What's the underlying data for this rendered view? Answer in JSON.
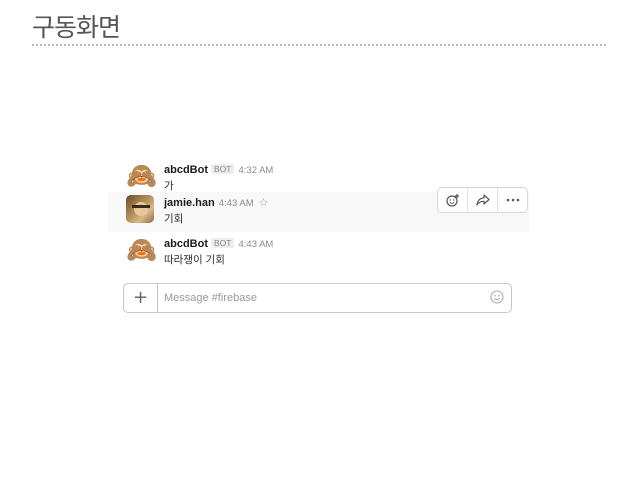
{
  "slide": {
    "title": "구동화면"
  },
  "messages": [
    {
      "author": "abcdBot",
      "badge": "BOT",
      "time": "4:32 AM",
      "text": "가",
      "avatar_icon": "see-no-evil-monkey-emoji"
    },
    {
      "author": "jamie.han",
      "time": "4:43 AM",
      "text": "기회",
      "avatar_icon": "user-photo"
    },
    {
      "author": "abcdBot",
      "badge": "BOT",
      "time": "4:43 AM",
      "text": "따라쟁이 기회",
      "avatar_icon": "see-no-evil-monkey-emoji"
    }
  ],
  "message_actions": {
    "icons": [
      "add-reaction-icon",
      "share-icon",
      "more-icon"
    ]
  },
  "composer": {
    "placeholder": "Message #firebase",
    "value": ""
  }
}
